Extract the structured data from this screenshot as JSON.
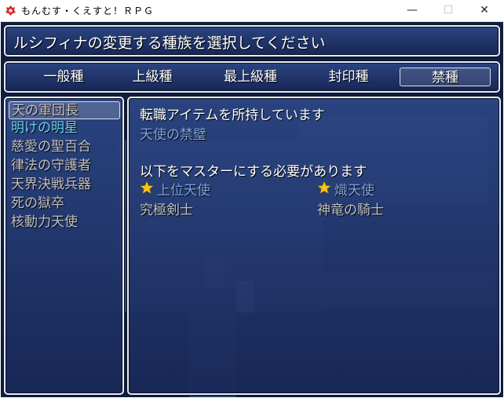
{
  "window": {
    "title": "もんむす・くえすと！ＲＰＧ",
    "minimize": "—",
    "maximize": "☐",
    "close": "✕"
  },
  "help": {
    "text": "ルシフィナの変更する種族を選択してください"
  },
  "categories": [
    {
      "label": "一般種",
      "selected": false
    },
    {
      "label": "上級種",
      "selected": false
    },
    {
      "label": "最上級種",
      "selected": false
    },
    {
      "label": "封印種",
      "selected": false
    },
    {
      "label": "禁種",
      "selected": true
    }
  ],
  "race_list": [
    {
      "label": "天の軍団長"
    },
    {
      "label": "明けの明星"
    },
    {
      "label": "慈愛の聖百合"
    },
    {
      "label": "律法の守護者"
    },
    {
      "label": "天界決戦兵器"
    },
    {
      "label": "死の獄卒"
    },
    {
      "label": "核動力天使"
    }
  ],
  "detail": {
    "item_heading": "転職アイテムを所持しています",
    "item_name": "天使の禁璧",
    "master_heading": "以下をマスターにする必要があります",
    "requirements": [
      {
        "label": "上位天使",
        "mastered": true
      },
      {
        "label": "熾天使",
        "mastered": true
      },
      {
        "label": "究極剣士",
        "mastered": false
      },
      {
        "label": "神竜の騎士",
        "mastered": false
      }
    ]
  },
  "colors": {
    "window_fill": "#2c4684",
    "text_normal": "#ffffff",
    "text_disabled": "#c0c0c0",
    "text_current": "#69d0ee",
    "text_system": "#7fa3dc",
    "star": "#f5c518"
  }
}
